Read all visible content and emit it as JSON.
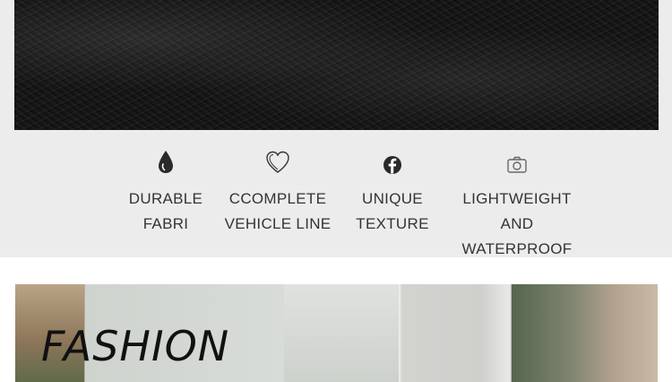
{
  "features": [
    {
      "icon": "water-drop-icon",
      "label": "DURABLE\nFABRI"
    },
    {
      "icon": "heart-icon",
      "label": "CCOMPLETE\nVEHICLE LINE"
    },
    {
      "icon": "facebook-icon",
      "label": "UNIQUE\nTEXTURE"
    },
    {
      "icon": "camera-icon",
      "label": "LIGHTWEIGHT AND\nWATERPROOF"
    }
  ],
  "banner": {
    "title": "FASHION"
  }
}
